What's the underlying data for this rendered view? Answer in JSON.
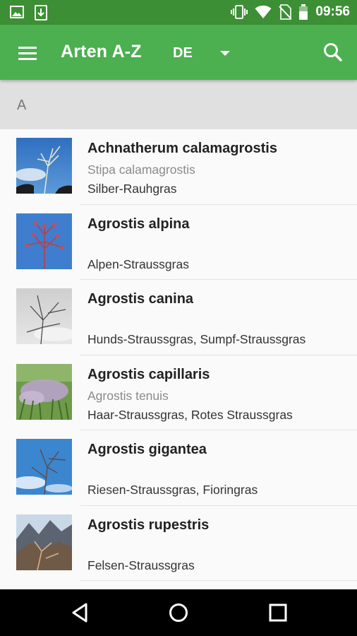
{
  "status_bar": {
    "time": "09:56",
    "icons": [
      "image-icon",
      "download-icon",
      "vibrate-icon",
      "wifi-icon",
      "no-sim-icon",
      "battery-icon"
    ]
  },
  "app_bar": {
    "title": "Arten A-Z",
    "language": "DE",
    "icons": [
      "menu-icon",
      "dropdown-arrow-icon",
      "search-icon"
    ]
  },
  "section": {
    "letter": "A"
  },
  "species": [
    {
      "name": "Achnatherum calamagrostis",
      "synonym": "Stipa calamagrostis",
      "common": "Silber-Rauhgras"
    },
    {
      "name": "Agrostis alpina",
      "synonym": "",
      "common": "Alpen-Straussgras"
    },
    {
      "name": "Agrostis canina",
      "synonym": "",
      "common": "Hunds-Straussgras, Sumpf-Straussgras"
    },
    {
      "name": "Agrostis capillaris",
      "synonym": "Agrostis tenuis",
      "common": "Haar-Straussgras, Rotes Straussgras"
    },
    {
      "name": "Agrostis gigantea",
      "synonym": "",
      "common": "Riesen-Straussgras, Fioringras"
    },
    {
      "name": "Agrostis rupestris",
      "synonym": "",
      "common": "Felsen-Straussgras"
    }
  ],
  "nav_bar": {
    "icons": [
      "back-icon",
      "home-icon",
      "recents-icon"
    ]
  },
  "colors": {
    "status_bar": "#3d8f35",
    "app_bar": "#4caf50",
    "section_header": "#e0e0e0"
  }
}
